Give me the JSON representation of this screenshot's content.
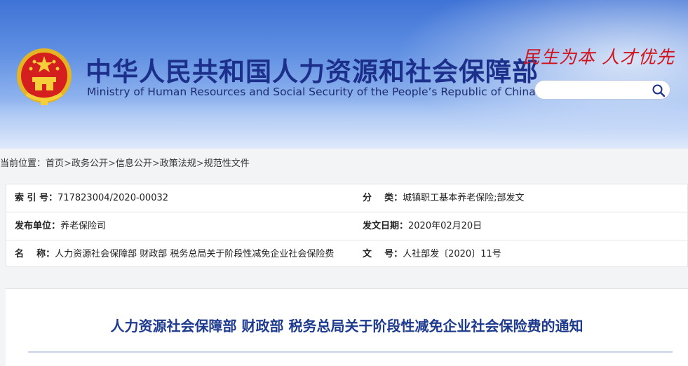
{
  "header": {
    "title_cn": "中华人民共和国人力资源和社会保障部",
    "title_en": "Ministry of Human Resources and Social Security of the People’s Republic of China",
    "slogan": "民生为本 人才优先",
    "search": {
      "placeholder": "",
      "icon": "search-icon"
    }
  },
  "breadcrumb": {
    "prefix": "当前位置：",
    "items": [
      "首页",
      "政务公开",
      "信息公开",
      "政策法规",
      "规范性文件"
    ],
    "separator": ">"
  },
  "info": {
    "index_label": "索 引 号：",
    "index_value": "717823004/2020-00032",
    "category_label": "分    类：",
    "category_value": "城镇职工基本养老保险;部发文",
    "publisher_label": "发布单位：",
    "publisher_value": "养老保险司",
    "date_label": "发文日期：",
    "date_value": "2020年02月20日",
    "name_label": "名    称：",
    "name_value": "人力资源社会保障部 财政部 税务总局关于阶段性减免企业社会保险费",
    "docno_label": "文    号：",
    "docno_value": "人社部发〔2020〕11号"
  },
  "article": {
    "title": "人力资源社会保障部 财政部 税务总局关于阶段性减免企业社会保险费的通知"
  },
  "colors": {
    "brand_blue": "#1c2f8a",
    "slogan_red": "#d0121b",
    "header_bg": "#5f8fe2"
  }
}
